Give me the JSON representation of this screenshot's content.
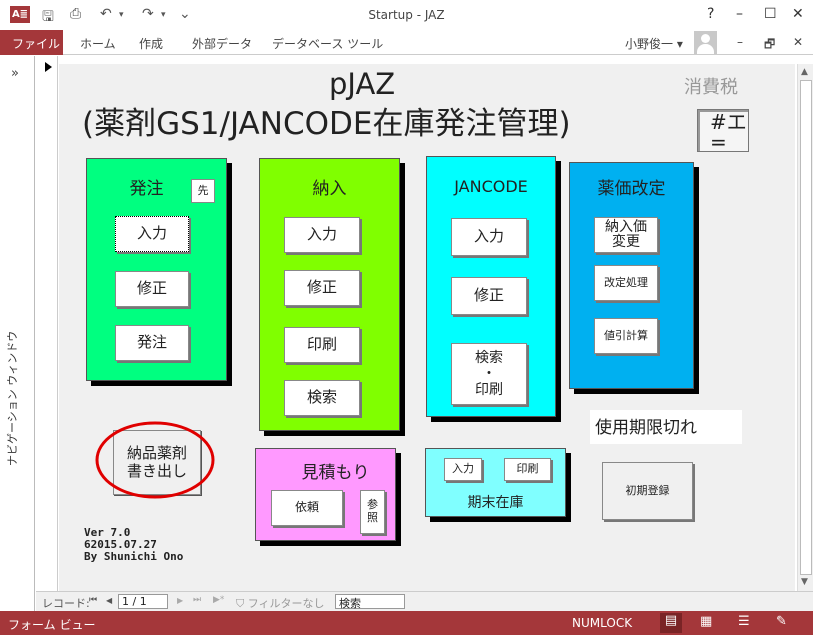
{
  "titlebar": {
    "title": "Startup - JAZ",
    "app_icon": "A≣",
    "help": "?",
    "minimize": "–",
    "maximize": "☐",
    "close": "✕"
  },
  "quickaccess": {
    "save": "🖫",
    "print": "⎙",
    "undo": "↶",
    "undo_arrow": "▾",
    "redo": "↷",
    "redo_arrow": "▾",
    "customize": "⌄"
  },
  "ribbon": {
    "tabs": [
      "ファイル",
      "ホーム",
      "作成",
      "外部データ",
      "データベース ツール"
    ],
    "user": "小野俊一 ▾",
    "min": "–",
    "restore": "🗗",
    "close": "✕"
  },
  "navpane": {
    "toggle": "»",
    "label": "ナビゲーション ウィンドウ"
  },
  "form": {
    "title1": "pJAZ",
    "title2": "(薬剤GS1/JANCODE在庫発注管理)",
    "tax": "消費税",
    "hash_field": "#エ\n=",
    "order": {
      "title": "発注",
      "first": "先",
      "input": "入力",
      "edit": "修正",
      "order": "発注"
    },
    "delivery": {
      "title": "納入",
      "input": "入力",
      "edit": "修正",
      "print": "印刷",
      "search": "検索"
    },
    "jancode": {
      "title": "JANCODE",
      "input": "入力",
      "edit": "修正",
      "search_print": "検索\n・\n印刷"
    },
    "price": {
      "title": "薬価改定",
      "delivery_change": "納入価\n変更",
      "revision": "改定処理",
      "discount": "値引計算"
    },
    "export_button": "納品薬剤\n書き出し",
    "estimate": {
      "title": "見積もり",
      "request": "依頼",
      "reference": "参\n照"
    },
    "stock": {
      "title": "期末在庫",
      "input": "入力",
      "print": "印刷"
    },
    "expired": "使用期限切れ",
    "initial": "初期登録",
    "version": "Ver 7.0\n62015.07.27\nBy Shunichi Ono"
  },
  "recnav": {
    "label": "レコード:",
    "first": "⏮",
    "prev": "◀",
    "position": "1 / 1",
    "next": "▶",
    "last": "⏭",
    "newrec": "▶*",
    "filter": "フィルターなし",
    "search": "検索"
  },
  "status": {
    "view": "フォーム ビュー",
    "numlock": "NUMLOCK"
  },
  "colors": {
    "order": "#00ff80",
    "delivery": "#80ff00",
    "jancode": "#00ffff",
    "price": "#00b0f0",
    "estimate": "#ff99ff",
    "stock": "#80ffff",
    "status": "#a4373a",
    "circle": "#e00000"
  }
}
